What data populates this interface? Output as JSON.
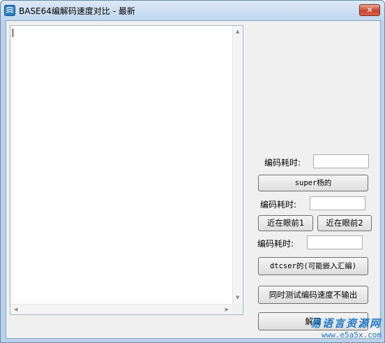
{
  "window": {
    "title": "BASE64编解码速度对比 - 最新",
    "close_glyph": "✕"
  },
  "right_panel": {
    "label1": "编码耗时:",
    "btn_superyang": "super杨的",
    "label2": "编码耗时:",
    "btn_near1": "近在眼前1",
    "btn_near2": "近在眼前2",
    "label3": "编码耗时:",
    "btn_dtcser": "dtcser的(可能嵌入汇编)",
    "btn_test_no_output": "同时测试编码速度不输出",
    "btn_decode": "解码"
  },
  "watermark": {
    "line1": "易语言资源网",
    "line2": "www.e5a5x.com"
  },
  "colors": {
    "accent": "#1e78c8",
    "close": "#c7462f"
  }
}
